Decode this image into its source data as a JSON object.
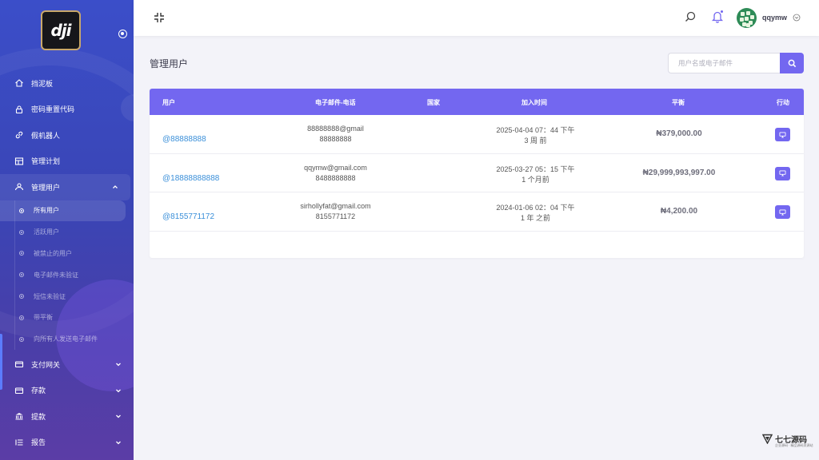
{
  "brand": {
    "logo_text": "dji"
  },
  "sidebar": {
    "items": [
      {
        "label": "挡泥板",
        "icon": "home-icon"
      },
      {
        "label": "密码重置代码",
        "icon": "lock-icon"
      },
      {
        "label": "假机器人",
        "icon": "link-icon"
      },
      {
        "label": "管理计划",
        "icon": "grid-icon"
      },
      {
        "label": "管理用户",
        "icon": "users-icon"
      }
    ],
    "manage_users_sub": [
      {
        "label": "所有用户"
      },
      {
        "label": "活跃用户"
      },
      {
        "label": "被禁止的用户"
      },
      {
        "label": "电子邮件未验证"
      },
      {
        "label": "短信未验证"
      },
      {
        "label": "带平衡"
      },
      {
        "label": "向所有人发送电子邮件"
      }
    ],
    "bottom_items": [
      {
        "label": "支付网关",
        "icon": "card-icon"
      },
      {
        "label": "存款",
        "icon": "wallet-icon"
      },
      {
        "label": "提款",
        "icon": "bank-icon"
      },
      {
        "label": "报告",
        "icon": "list-icon"
      }
    ]
  },
  "topbar": {
    "username": "qqymw"
  },
  "main": {
    "page_title": "管理用户",
    "search": {
      "placeholder": "用户名或电子邮件"
    },
    "table": {
      "columns": [
        "用户",
        "电子邮件-电话",
        "国家",
        "加入时间",
        "平衡",
        "行动"
      ],
      "rows": [
        {
          "user": "@88888888",
          "email": "88888888@gmail",
          "phone": "88888888",
          "country": "",
          "joined": "2025-04-04 07：44 下午",
          "ago": "3 周 前",
          "balance": "₦379,000.00"
        },
        {
          "user": "@18888888888",
          "email": "qqymw@gmail.com",
          "phone": "8488888888",
          "country": "",
          "joined": "2025-03-27 05：15 下午",
          "ago": "1 个月前",
          "balance": "₦29,999,993,997.00"
        },
        {
          "user": "@8155771172",
          "email": "sirhollyfat@gmail.com",
          "phone": "8155771172",
          "country": "",
          "joined": "2024-01-06 02：04 下午",
          "ago": "1 年 之前",
          "balance": "₦4,200.00"
        }
      ]
    }
  },
  "watermark": {
    "text": "七七源码",
    "sub": "企业源码 · 精品源码资源站"
  },
  "colors": {
    "accent": "#7367f0",
    "sidebar_top": "#3b4ec9",
    "sidebar_bottom": "#5b3da6",
    "link": "#3a8fd9"
  }
}
